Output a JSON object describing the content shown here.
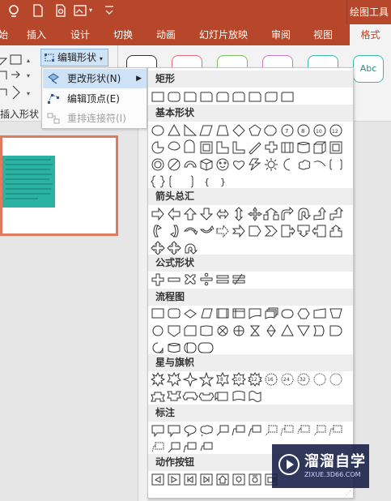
{
  "app": {
    "context_tab_group": "绘图工具",
    "accent_color": "#b7472a"
  },
  "tabs": [
    {
      "label": "始"
    },
    {
      "label": "插入"
    },
    {
      "label": "设计"
    },
    {
      "label": "切换"
    },
    {
      "label": "动画"
    },
    {
      "label": "幻灯片放映"
    },
    {
      "label": "审阅"
    },
    {
      "label": "视图"
    },
    {
      "label": "格式",
      "active": true
    }
  ],
  "ribbon": {
    "edit_shape_button": "编辑形状",
    "insert_shapes_group": "插入形状",
    "style_sample_text": "Abc"
  },
  "submenu": {
    "items": [
      {
        "label": "更改形状(N)",
        "icon": "change-shape-icon",
        "highlighted": true,
        "has_submenu": true
      },
      {
        "label": "编辑顶点(E)",
        "icon": "edit-points-icon"
      },
      {
        "label": "重排连接符(I)",
        "icon": "reroute-connectors-icon",
        "disabled": true
      }
    ]
  },
  "shapes_panel": {
    "categories": [
      {
        "label": "矩形"
      },
      {
        "label": "基本形状"
      },
      {
        "label": "箭头总汇"
      },
      {
        "label": "公式形状"
      },
      {
        "label": "流程图"
      },
      {
        "label": "星与旗帜"
      },
      {
        "label": "标注"
      },
      {
        "label": "动作按钮"
      }
    ],
    "text_shapes": [
      "{",
      "}"
    ],
    "star_labels": [
      "8",
      "10",
      "12",
      "16",
      "24",
      "32"
    ]
  },
  "watermark": {
    "title": "溜溜自学",
    "subtitle": "ZIXUE.3D66.COM"
  }
}
